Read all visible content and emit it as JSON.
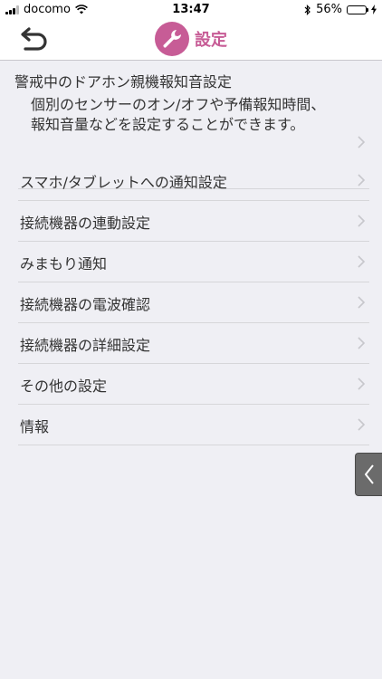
{
  "status_bar": {
    "carrier": "docomo",
    "time": "13:47",
    "battery_percent": "56%",
    "battery_level": 0.56
  },
  "nav": {
    "title": "設定"
  },
  "section": {
    "title": "警戒中のドアホン親機報知音設定",
    "description": "個別のセンサーのオン/オフや予備報知時間、報知音量などを設定することができます。"
  },
  "menu_items": [
    {
      "label": "スマホ/タブレットへの通知設定"
    },
    {
      "label": "接続機器の連動設定"
    },
    {
      "label": "みまもり通知"
    },
    {
      "label": "接続機器の電波確認"
    },
    {
      "label": "接続機器の詳細設定"
    },
    {
      "label": "その他の設定"
    },
    {
      "label": "情報"
    }
  ],
  "colors": {
    "accent": "#c75c96",
    "background": "#efeff4",
    "separator": "#d6d6d9"
  }
}
